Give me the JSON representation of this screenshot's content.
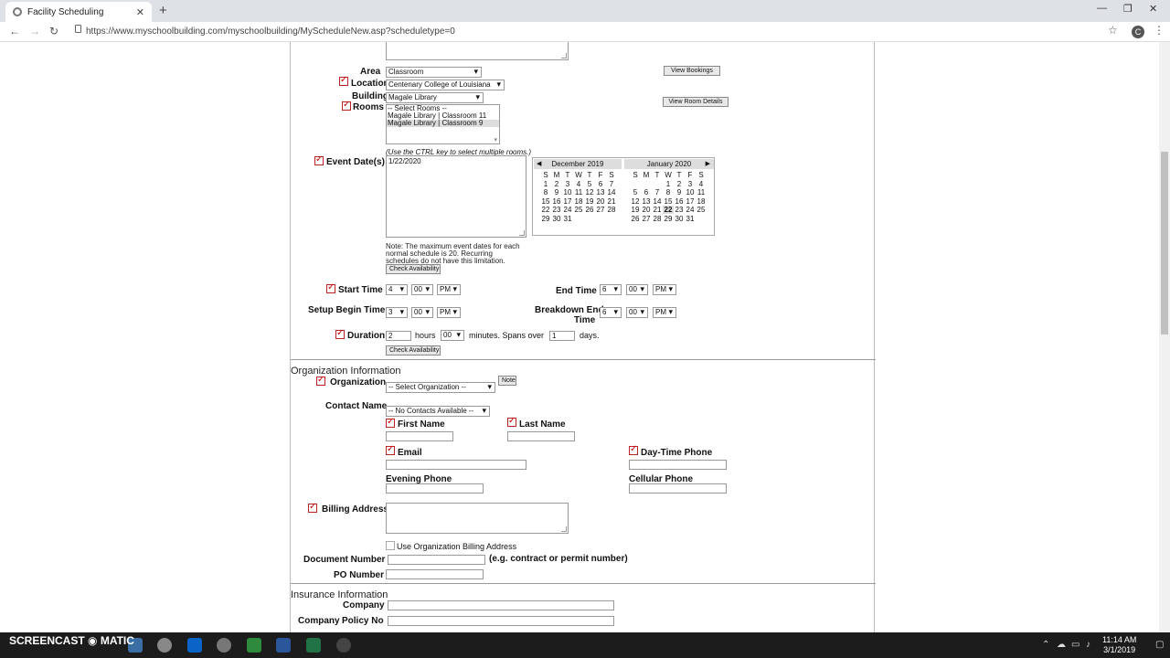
{
  "browser": {
    "tab_title": "Facility Scheduling",
    "url": "https://www.myschoolbuilding.com/myschoolbuilding/MyScheduleNew.asp?scheduletype=0",
    "avatar_letter": "C",
    "minimize": "—",
    "restore": "❐",
    "close": "✕",
    "new_tab": "+",
    "back": "←",
    "forward": "→",
    "reload": "↻"
  },
  "form": {
    "area_label": "Area",
    "area_value": "Classroom",
    "location_label": "Location",
    "location_value": "Centenary College of Louisiana",
    "building_label": "Building",
    "building_value": "Magale Library",
    "rooms_label": "Rooms",
    "rooms_options": [
      "-- Select Rooms --",
      "Magale Library | Classroom 11",
      "Magale Library | Classroom 9"
    ],
    "rooms_hint": "(Use the CTRL key to select multiple rooms.)",
    "view_bookings": "View Bookings",
    "view_room_details": "View Room Details",
    "event_dates_label": "Event Date(s)",
    "event_dates_value": "1/22/2020",
    "max_note": "Note: The maximum event dates for each normal schedule is 20. Recurring schedules do not have this limitation.",
    "check_availability": "Check Availability",
    "start_time_label": "Start Time",
    "start_hour": "4",
    "start_min": "00",
    "start_ampm": "PM",
    "end_time_label": "End Time",
    "end_hour": "6",
    "end_min": "00",
    "end_ampm": "PM",
    "setup_label": "Setup Begin Time",
    "setup_hour": "3",
    "setup_min": "00",
    "setup_ampm": "PM",
    "breakdown_label_1": "Breakdown End",
    "breakdown_label_2": "Time",
    "breakdown_hour": "6",
    "breakdown_min": "00",
    "breakdown_ampm": "PM",
    "duration_label": "Duration",
    "duration_hours": "2",
    "hours_text": "hours",
    "duration_minutes": "00",
    "minutes_text": "minutes. Spans over",
    "spans_days": "1",
    "days_text": "days."
  },
  "calendar": {
    "left_month": "December 2019",
    "right_month": "January 2020",
    "weekdays": [
      "S",
      "M",
      "T",
      "W",
      "T",
      "F",
      "S"
    ],
    "left_weeks": [
      [
        "1",
        "2",
        "3",
        "4",
        "5",
        "6",
        "7"
      ],
      [
        "8",
        "9",
        "10",
        "11",
        "12",
        "13",
        "14"
      ],
      [
        "15",
        "16",
        "17",
        "18",
        "19",
        "20",
        "21"
      ],
      [
        "22",
        "23",
        "24",
        "25",
        "26",
        "27",
        "28"
      ],
      [
        "29",
        "30",
        "31",
        "",
        "",
        "",
        ""
      ]
    ],
    "right_weeks": [
      [
        "",
        "",
        "",
        "1",
        "2",
        "3",
        "4"
      ],
      [
        "5",
        "6",
        "7",
        "8",
        "9",
        "10",
        "11"
      ],
      [
        "12",
        "13",
        "14",
        "15",
        "16",
        "17",
        "18"
      ],
      [
        "19",
        "20",
        "21",
        "22",
        "23",
        "24",
        "25"
      ],
      [
        "26",
        "27",
        "28",
        "29",
        "30",
        "31",
        ""
      ]
    ],
    "selected_day": "22"
  },
  "org": {
    "section_title": "Organization Information",
    "organization_label": "Organization",
    "organization_value": "-- Select Organization --",
    "note_button": "Note",
    "contact_label": "Contact Name",
    "contact_value": "-- No Contacts Available --",
    "first_name": "First Name",
    "last_name": "Last Name",
    "email": "Email",
    "daytime_phone": "Day-Time Phone",
    "evening_phone": "Evening Phone",
    "cellular_phone": "Cellular Phone",
    "billing_address": "Billing Address",
    "use_org_billing": "Use Organization Billing Address",
    "document_number": "Document Number",
    "document_hint": "(e.g. contract or permit number)",
    "po_number": "PO Number"
  },
  "insurance": {
    "section_title": "Insurance Information",
    "company": "Company",
    "company_policy": "Company",
    "policy_no": "Policy No"
  },
  "taskbar": {
    "time": "11:14 AM",
    "date": "3/1/2019",
    "watermark_small": "RECORDED WITH",
    "watermark": "SCREENCAST",
    "watermark_2": "MATIC"
  }
}
